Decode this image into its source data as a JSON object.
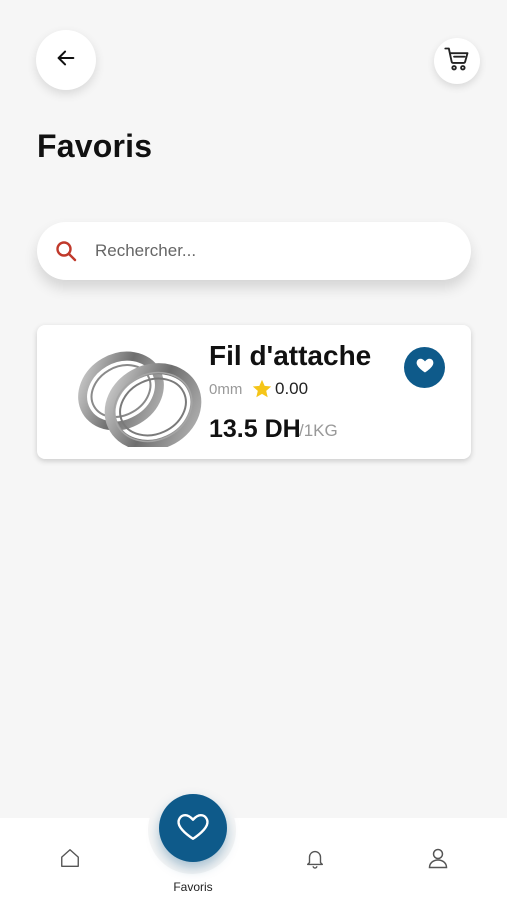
{
  "header": {
    "title": "Favoris"
  },
  "search": {
    "placeholder": "Rechercher..."
  },
  "favorites": [
    {
      "name": "Fil d'attache",
      "size": "0mm",
      "rating": "0.00",
      "price": "13.5 DH",
      "unit": "/1KG",
      "favorited": true
    }
  ],
  "bottom_nav": {
    "items": [
      {
        "icon": "home-icon",
        "label": ""
      },
      {
        "icon": "heart-icon",
        "label": "Favoris",
        "active": true
      },
      {
        "icon": "bell-icon",
        "label": ""
      },
      {
        "icon": "user-icon",
        "label": ""
      }
    ]
  },
  "colors": {
    "accent": "#0e5a8a",
    "background": "#f6f6f6",
    "search_icon": "#c0392b",
    "star": "#f5c518"
  }
}
